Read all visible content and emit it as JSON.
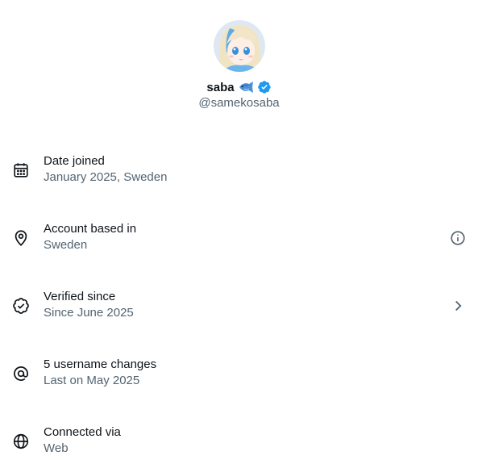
{
  "profile": {
    "display_name": "saba",
    "emoji": "fish-emoji",
    "verified": true,
    "handle": "@samekosaba"
  },
  "rows": [
    {
      "icon": "calendar-icon",
      "title": "Date joined",
      "subtitle": "January 2025, Sweden"
    },
    {
      "icon": "location-pin-icon",
      "title": "Account based in",
      "subtitle": "Sweden",
      "action_icon": "info-icon"
    },
    {
      "icon": "verified-check-icon",
      "title": "Verified since",
      "subtitle": "Since June 2025",
      "action_icon": "chevron-right-icon"
    },
    {
      "icon": "at-sign-icon",
      "title": "5 username changes",
      "subtitle": "Last on May 2025"
    },
    {
      "icon": "globe-icon",
      "title": "Connected via",
      "subtitle": "Web"
    }
  ],
  "colors": {
    "primary_text": "#0f1419",
    "secondary_text": "#536471",
    "verified_blue": "#1d9bf0"
  }
}
